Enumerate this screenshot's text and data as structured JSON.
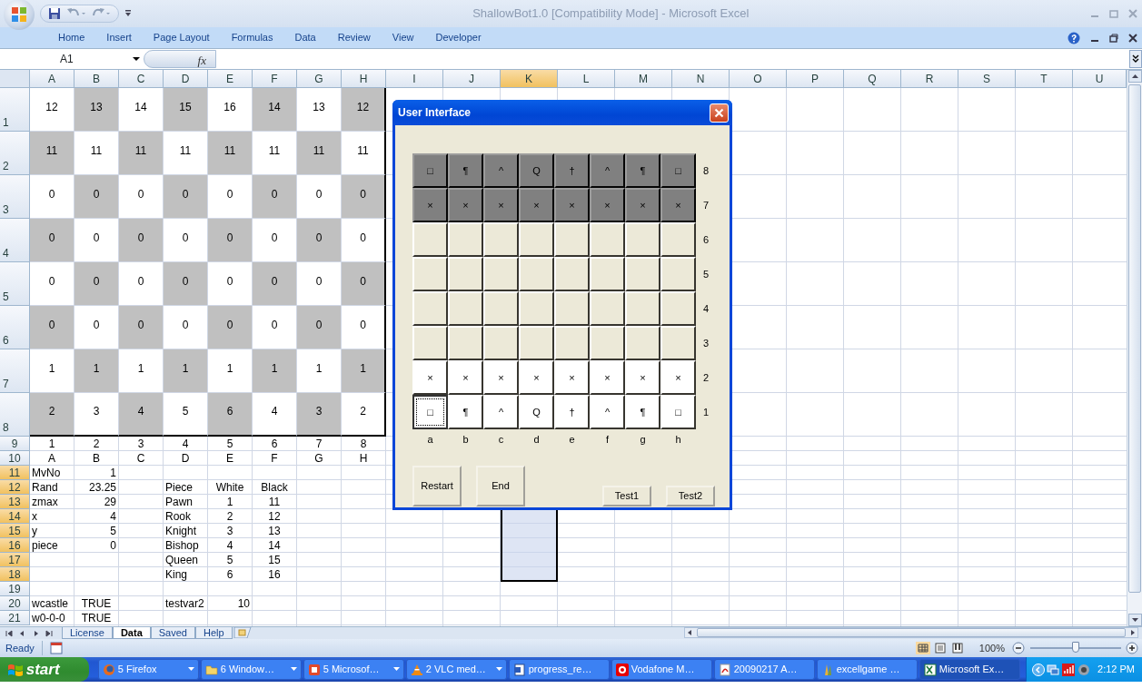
{
  "window": {
    "title": "ShallowBot1.0  [Compatibility Mode] - Microsoft Excel"
  },
  "ribbon_tabs": [
    {
      "label": "Home"
    },
    {
      "label": "Insert"
    },
    {
      "label": "Page Layout"
    },
    {
      "label": "Formulas"
    },
    {
      "label": "Data"
    },
    {
      "label": "Review"
    },
    {
      "label": "View"
    },
    {
      "label": "Developer"
    }
  ],
  "formula_bar": {
    "name_box": "A1",
    "function_label": "fx"
  },
  "column_headers": [
    {
      "label": "A",
      "selected": false
    },
    {
      "label": "B",
      "selected": false
    },
    {
      "label": "C",
      "selected": false
    },
    {
      "label": "D",
      "selected": false
    },
    {
      "label": "E",
      "selected": false
    },
    {
      "label": "F",
      "selected": false
    },
    {
      "label": "G",
      "selected": false
    },
    {
      "label": "H",
      "selected": false
    },
    {
      "label": "I",
      "selected": false
    },
    {
      "label": "J",
      "selected": false
    },
    {
      "label": "K",
      "selected": true
    },
    {
      "label": "L",
      "selected": false
    },
    {
      "label": "M",
      "selected": false
    },
    {
      "label": "N",
      "selected": false
    },
    {
      "label": "O",
      "selected": false
    },
    {
      "label": "P",
      "selected": false
    },
    {
      "label": "Q",
      "selected": false
    },
    {
      "label": "R",
      "selected": false
    },
    {
      "label": "S",
      "selected": false
    },
    {
      "label": "T",
      "selected": false
    },
    {
      "label": "U",
      "selected": false
    }
  ],
  "rows": [
    {
      "header": "1",
      "selected": false,
      "kind": "board",
      "cells": [
        "12",
        "13",
        "14",
        "15",
        "16",
        "14",
        "13",
        "12"
      ]
    },
    {
      "header": "2",
      "selected": false,
      "kind": "board",
      "cells": [
        "11",
        "11",
        "11",
        "11",
        "11",
        "11",
        "11",
        "11"
      ]
    },
    {
      "header": "3",
      "selected": false,
      "kind": "board",
      "cells": [
        "0",
        "0",
        "0",
        "0",
        "0",
        "0",
        "0",
        "0"
      ]
    },
    {
      "header": "4",
      "selected": false,
      "kind": "board",
      "cells": [
        "0",
        "0",
        "0",
        "0",
        "0",
        "0",
        "0",
        "0"
      ]
    },
    {
      "header": "5",
      "selected": false,
      "kind": "board",
      "cells": [
        "0",
        "0",
        "0",
        "0",
        "0",
        "0",
        "0",
        "0"
      ]
    },
    {
      "header": "6",
      "selected": false,
      "kind": "board",
      "cells": [
        "0",
        "0",
        "0",
        "0",
        "0",
        "0",
        "0",
        "0"
      ]
    },
    {
      "header": "7",
      "selected": false,
      "kind": "board",
      "cells": [
        "1",
        "1",
        "1",
        "1",
        "1",
        "1",
        "1",
        "1"
      ]
    },
    {
      "header": "8",
      "selected": false,
      "kind": "board",
      "cells": [
        "2",
        "3",
        "4",
        "5",
        "6",
        "4",
        "3",
        "2"
      ]
    },
    {
      "header": "9",
      "selected": false,
      "kind": "axis",
      "cells": [
        "1",
        "2",
        "3",
        "4",
        "5",
        "6",
        "7",
        "8"
      ]
    },
    {
      "header": "10",
      "selected": false,
      "kind": "axis",
      "cells": [
        "A",
        "B",
        "C",
        "D",
        "E",
        "F",
        "G",
        "H"
      ]
    },
    {
      "header": "11",
      "selected": true,
      "kind": "data",
      "cells": [
        "MvNo",
        "1"
      ]
    },
    {
      "header": "12",
      "selected": true,
      "kind": "table",
      "cells": [
        "Rand",
        "23.25",
        null,
        "Piece",
        "White",
        "Black"
      ]
    },
    {
      "header": "13",
      "selected": true,
      "kind": "table",
      "cells": [
        "zmax",
        "29",
        null,
        "Pawn",
        "1",
        "11"
      ]
    },
    {
      "header": "14",
      "selected": true,
      "kind": "table",
      "cells": [
        "x",
        "4",
        null,
        "Rook",
        "2",
        "12"
      ]
    },
    {
      "header": "15",
      "selected": true,
      "kind": "table",
      "cells": [
        "y",
        "5",
        null,
        "Knight",
        "3",
        "13"
      ]
    },
    {
      "header": "16",
      "selected": true,
      "kind": "table",
      "cells": [
        "piece",
        "0",
        null,
        "Bishop",
        "4",
        "14"
      ]
    },
    {
      "header": "17",
      "selected": true,
      "kind": "table",
      "cells": [
        null,
        null,
        null,
        "Queen",
        "5",
        "15"
      ]
    },
    {
      "header": "18",
      "selected": true,
      "kind": "table",
      "cells": [
        null,
        null,
        null,
        "King",
        "6",
        "16"
      ]
    },
    {
      "header": "19",
      "selected": false,
      "kind": "data"
    },
    {
      "header": "20",
      "selected": false,
      "kind": "data",
      "cells": [
        "wcastle",
        "TRUE",
        null,
        "testvar2",
        "10"
      ]
    },
    {
      "header": "21",
      "selected": false,
      "kind": "data",
      "cells": [
        "w0-0-0",
        "TRUE"
      ]
    }
  ],
  "dialog": {
    "title": "User Interface",
    "ranks": [
      {
        "label": "8",
        "kind": "dark",
        "squares": [
          {
            "piece": "□",
            "focused": false
          },
          {
            "piece": "¶",
            "focused": false
          },
          {
            "piece": "^",
            "focused": false
          },
          {
            "piece": "Q",
            "focused": false
          },
          {
            "piece": "†",
            "focused": false
          },
          {
            "piece": "^",
            "focused": false
          },
          {
            "piece": "¶",
            "focused": false
          },
          {
            "piece": "□",
            "focused": false
          }
        ]
      },
      {
        "label": "7",
        "kind": "dark",
        "squares": [
          {
            "piece": "×",
            "focused": false
          },
          {
            "piece": "×",
            "focused": false
          },
          {
            "piece": "×",
            "focused": false
          },
          {
            "piece": "×",
            "focused": false
          },
          {
            "piece": "×",
            "focused": false
          },
          {
            "piece": "×",
            "focused": false
          },
          {
            "piece": "×",
            "focused": false
          },
          {
            "piece": "×",
            "focused": false
          }
        ]
      },
      {
        "label": "6",
        "kind": "empty",
        "squares": [
          {
            "focused": false
          },
          {
            "focused": false
          },
          {
            "focused": false
          },
          {
            "focused": false
          },
          {
            "focused": false
          },
          {
            "focused": false
          },
          {
            "focused": false
          },
          {
            "focused": false
          }
        ]
      },
      {
        "label": "5",
        "kind": "empty",
        "squares": [
          {
            "focused": false
          },
          {
            "focused": false
          },
          {
            "focused": false
          },
          {
            "focused": false
          },
          {
            "focused": false
          },
          {
            "focused": false
          },
          {
            "focused": false
          },
          {
            "focused": false
          }
        ]
      },
      {
        "label": "4",
        "kind": "empty",
        "squares": [
          {
            "focused": false
          },
          {
            "focused": false
          },
          {
            "focused": false
          },
          {
            "focused": false
          },
          {
            "focused": false
          },
          {
            "focused": false
          },
          {
            "focused": false
          },
          {
            "focused": false
          }
        ]
      },
      {
        "label": "3",
        "kind": "empty",
        "squares": [
          {
            "focused": false
          },
          {
            "focused": false
          },
          {
            "focused": false
          },
          {
            "focused": false
          },
          {
            "focused": false
          },
          {
            "focused": false
          },
          {
            "focused": false
          },
          {
            "focused": false
          }
        ]
      },
      {
        "label": "2",
        "kind": "light",
        "squares": [
          {
            "piece": "×",
            "focused": false
          },
          {
            "piece": "×",
            "focused": false
          },
          {
            "piece": "×",
            "focused": false
          },
          {
            "piece": "×",
            "focused": false
          },
          {
            "piece": "×",
            "focused": false
          },
          {
            "piece": "×",
            "focused": false
          },
          {
            "piece": "×",
            "focused": false
          },
          {
            "piece": "×",
            "focused": false
          }
        ]
      },
      {
        "label": "1",
        "kind": "light",
        "squares": [
          {
            "piece": "□",
            "focused": true
          },
          {
            "piece": "¶",
            "focused": false
          },
          {
            "piece": "^",
            "focused": false
          },
          {
            "piece": "Q",
            "focused": false
          },
          {
            "piece": "†",
            "focused": false
          },
          {
            "piece": "^",
            "focused": false
          },
          {
            "piece": "¶",
            "focused": false
          },
          {
            "piece": "□",
            "focused": false
          }
        ]
      }
    ],
    "files": [
      "a",
      "b",
      "c",
      "d",
      "e",
      "f",
      "g",
      "h"
    ],
    "buttons": [
      {
        "label": "Restart",
        "kind": "large"
      },
      {
        "label": "End",
        "kind": "large"
      },
      {
        "label": "Test1",
        "kind": "small"
      },
      {
        "label": "Test2",
        "kind": "small"
      }
    ]
  },
  "sheet_tabs": [
    {
      "label": "License",
      "selected": false
    },
    {
      "label": "Data",
      "selected": true
    },
    {
      "label": "Saved",
      "selected": false
    },
    {
      "label": "Help",
      "selected": false
    }
  ],
  "status_bar": {
    "text": "Ready",
    "zoom": "100%",
    "zoom_slider": {
      "level": 0.5
    }
  },
  "taskbar": {
    "start": "start",
    "items": [
      {
        "label": "5 Firefox",
        "grouped": true,
        "selected": false,
        "kind": "firefox"
      },
      {
        "label": "6 Window…",
        "grouped": true,
        "selected": false,
        "kind": "folder"
      },
      {
        "label": "5 Microsof…",
        "grouped": true,
        "selected": false,
        "kind": "office"
      },
      {
        "label": "2 VLC med…",
        "grouped": true,
        "selected": false,
        "kind": "cone"
      },
      {
        "label": "progress_re…",
        "grouped": false,
        "selected": false,
        "kind": "doc"
      },
      {
        "label": "Vodafone M…",
        "grouped": false,
        "selected": false,
        "kind": "vodafone"
      },
      {
        "label": "20090217 A…",
        "grouped": false,
        "selected": false,
        "kind": "pdf"
      },
      {
        "label": "excellgame …",
        "grouped": false,
        "selected": false,
        "kind": "tools"
      },
      {
        "label": "Microsoft Ex…",
        "grouped": false,
        "selected": true,
        "kind": "excel"
      }
    ],
    "clock": "2:12 PM"
  }
}
